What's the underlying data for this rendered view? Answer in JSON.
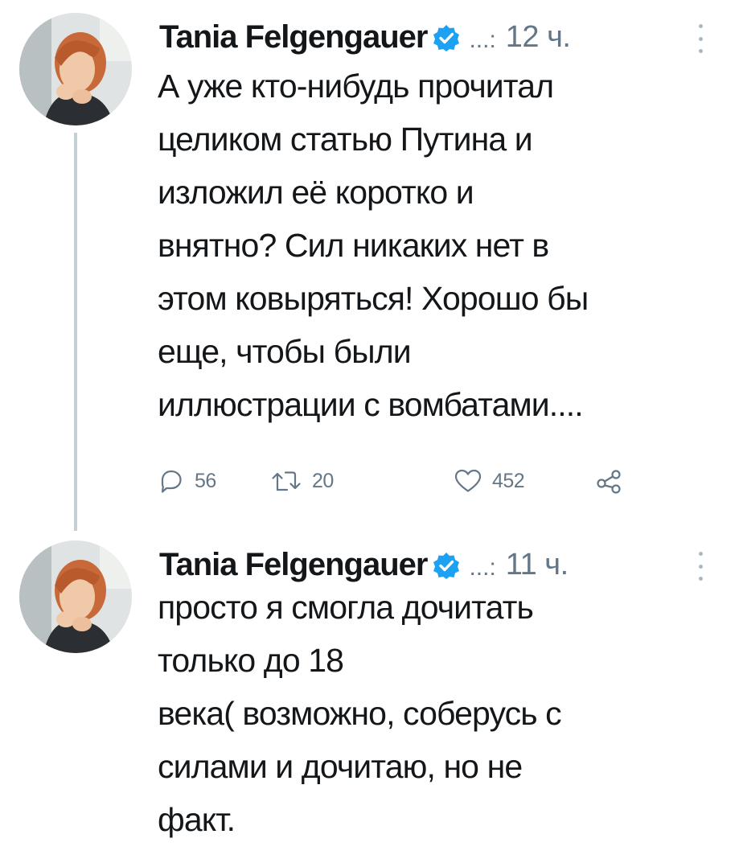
{
  "tweets": [
    {
      "author": {
        "name": "Tania Felgengauer",
        "handle": "...:",
        "avatar": "profile-photo-woman-red-hair"
      },
      "time": "12 ч.",
      "lines": [
        "А уже кто-нибудь прочитал",
        "целиком статью Путина и",
        "изложил её коротко и",
        "внятно? Сил никаких нет в",
        "этом ковыряться! Хорошо бы",
        "еще, чтобы были",
        "иллюстрации с вомбатами...."
      ],
      "actions": {
        "replies": "56",
        "retweets": "20",
        "likes": "452"
      }
    },
    {
      "author": {
        "name": "Tania Felgengauer",
        "handle": "...:",
        "avatar": "profile-photo-woman-red-hair"
      },
      "time": "11 ч.",
      "lines": [
        "просто я смогла дочитать",
        "только до 18",
        "века( возможно, соберусь с",
        "силами и дочитаю, но не",
        "факт."
      ]
    }
  ],
  "icons": {
    "verified": "verified-badge-icon",
    "menu": "more-vertical-icon",
    "reply": "reply-icon",
    "retweet": "retweet-icon",
    "like": "heart-icon",
    "share": "share-icon"
  },
  "colors": {
    "verified": "#1da1f2",
    "secondary_text": "#657786",
    "thread_line": "#c4cfd6",
    "text": "#14171a"
  }
}
